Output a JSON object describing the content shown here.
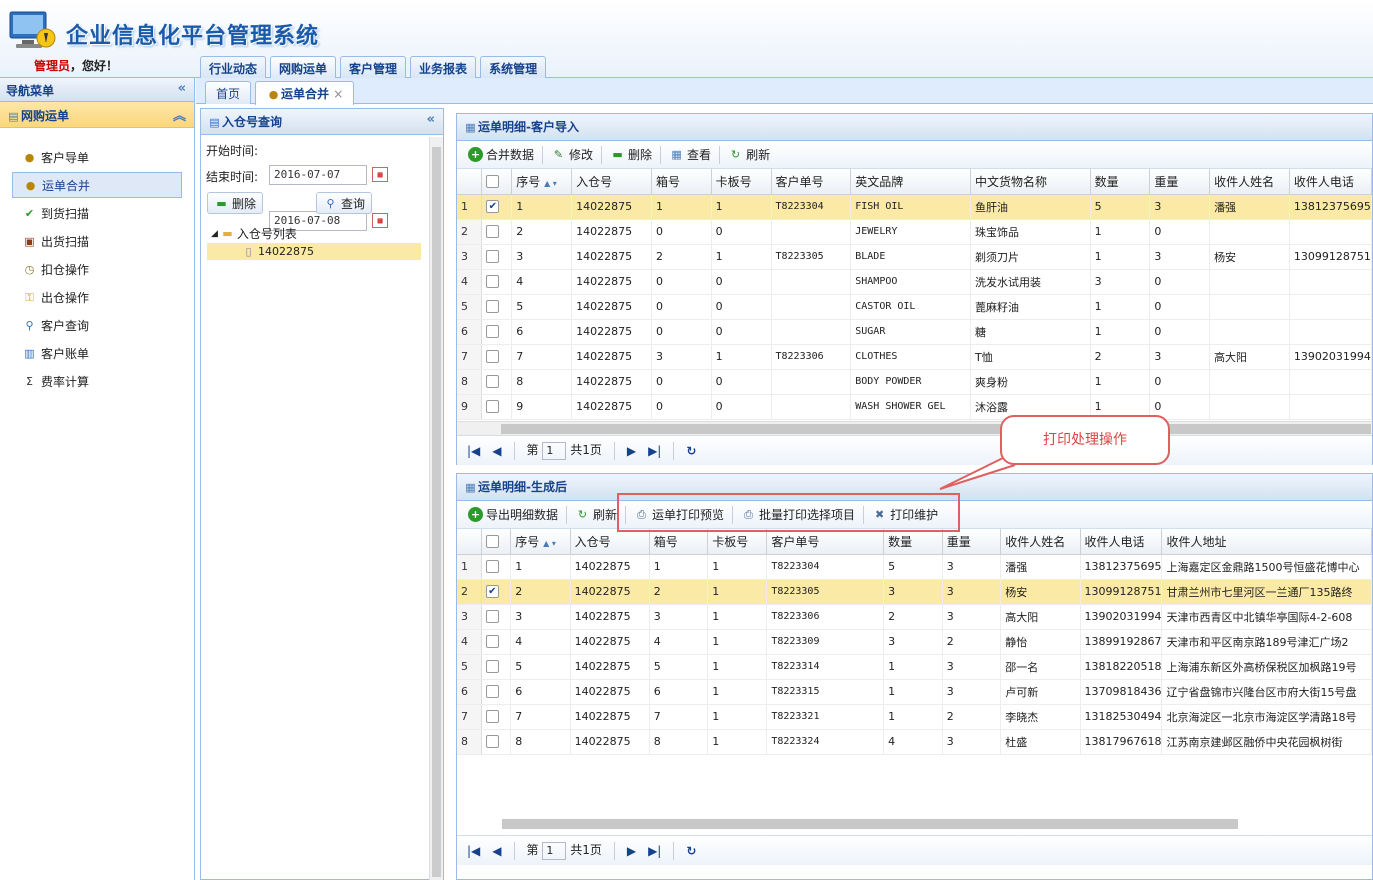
{
  "header": {
    "title": "企业信息化平台管理系统",
    "greeting_role": "管理员",
    "greeting_suffix": "，您好！"
  },
  "topnav": [
    "行业动态",
    "网购运单",
    "客户管理",
    "业务报表",
    "系统管理"
  ],
  "nav": {
    "title": "导航菜单",
    "section": "网购运单",
    "items": [
      {
        "label": "客户导单",
        "icon": "user-icon"
      },
      {
        "label": "运单合并",
        "icon": "users-icon"
      },
      {
        "label": "到货扫描",
        "icon": "check-icon"
      },
      {
        "label": "出货扫描",
        "icon": "image-icon"
      },
      {
        "label": "扣仓操作",
        "icon": "clock-icon"
      },
      {
        "label": "出仓操作",
        "icon": "key-icon"
      },
      {
        "label": "客户查询",
        "icon": "magnifier-icon"
      },
      {
        "label": "客户账单",
        "icon": "book-icon"
      },
      {
        "label": "费率计算",
        "icon": "sigma-icon"
      }
    ]
  },
  "tabs": {
    "home": "首页",
    "active": "运单合并",
    "close": "×"
  },
  "query": {
    "title": "入仓号查询",
    "start_label": "开始时间:",
    "start_value": "2016-07-07",
    "end_label": "结束时间:",
    "end_value": "2016-07-08",
    "delete": "删除",
    "search": "查询",
    "tree_root": "入仓号列表",
    "tree_item": "14022875"
  },
  "grid1": {
    "title": "运单明细-客户导入",
    "toolbar": [
      "合并数据",
      "修改",
      "删除",
      "查看",
      "刷新"
    ],
    "columns": [
      "序号",
      "入仓号",
      "箱号",
      "卡板号",
      "客户单号",
      "英文品牌",
      "中文货物名称",
      "数量",
      "重量",
      "收件人姓名",
      "收件人电话"
    ],
    "rows": [
      {
        "checked": true,
        "cells": [
          "1",
          "14022875",
          "1",
          "1",
          "T8223304",
          "FISH OIL",
          "鱼肝油",
          "5",
          "3",
          "潘强",
          "13812375695"
        ]
      },
      {
        "checked": false,
        "cells": [
          "2",
          "14022875",
          "0",
          "0",
          "",
          "JEWELRY",
          "珠宝饰品",
          "1",
          "0",
          "",
          ""
        ]
      },
      {
        "checked": false,
        "cells": [
          "3",
          "14022875",
          "2",
          "1",
          "T8223305",
          "BLADE",
          "剃须刀片",
          "1",
          "3",
          "杨安",
          "13099128751"
        ]
      },
      {
        "checked": false,
        "cells": [
          "4",
          "14022875",
          "0",
          "0",
          "",
          "SHAMPOO",
          "洗发水试用装",
          "3",
          "0",
          "",
          ""
        ]
      },
      {
        "checked": false,
        "cells": [
          "5",
          "14022875",
          "0",
          "0",
          "",
          "CASTOR OIL",
          "蓖麻籽油",
          "1",
          "0",
          "",
          ""
        ]
      },
      {
        "checked": false,
        "cells": [
          "6",
          "14022875",
          "0",
          "0",
          "",
          "SUGAR",
          "糖",
          "1",
          "0",
          "",
          ""
        ]
      },
      {
        "checked": false,
        "cells": [
          "7",
          "14022875",
          "3",
          "1",
          "T8223306",
          "CLOTHES",
          "T恤",
          "2",
          "3",
          "高大阳",
          "13902031994"
        ]
      },
      {
        "checked": false,
        "cells": [
          "8",
          "14022875",
          "0",
          "0",
          "",
          "BODY POWDER",
          "爽身粉",
          "1",
          "0",
          "",
          ""
        ]
      },
      {
        "checked": false,
        "cells": [
          "9",
          "14022875",
          "0",
          "0",
          "",
          "WASH SHOWER GEL",
          "沐浴露",
          "1",
          "0",
          "",
          ""
        ]
      }
    ],
    "pager": {
      "prefix": "第",
      "page": "1",
      "total": "共1页"
    }
  },
  "grid2": {
    "title": "运单明细-生成后",
    "toolbar": [
      "导出明细数据",
      "刷新",
      "运单打印预览",
      "批量打印选择项目",
      "打印维护"
    ],
    "columns": [
      "序号",
      "入仓号",
      "箱号",
      "卡板号",
      "客户单号",
      "数量",
      "重量",
      "收件人姓名",
      "收件人电话",
      "收件人地址"
    ],
    "rows": [
      {
        "checked": false,
        "cells": [
          "1",
          "14022875",
          "1",
          "1",
          "T8223304",
          "5",
          "3",
          "潘强",
          "13812375695",
          "上海嘉定区金鼎路1500号恒盛花博中心"
        ]
      },
      {
        "checked": true,
        "cells": [
          "2",
          "14022875",
          "2",
          "1",
          "T8223305",
          "3",
          "3",
          "杨安",
          "13099128751",
          "甘肃兰州市七里河区一兰通厂135路终"
        ]
      },
      {
        "checked": false,
        "cells": [
          "3",
          "14022875",
          "3",
          "1",
          "T8223306",
          "2",
          "3",
          "高大阳",
          "13902031994",
          "天津市西青区中北镇华亭国际4-2-608"
        ]
      },
      {
        "checked": false,
        "cells": [
          "4",
          "14022875",
          "4",
          "1",
          "T8223309",
          "3",
          "2",
          "静怡",
          "13899192867",
          "天津市和平区南京路189号津汇广场2"
        ]
      },
      {
        "checked": false,
        "cells": [
          "5",
          "14022875",
          "5",
          "1",
          "T8223314",
          "1",
          "3",
          "邵一名",
          "13818220518",
          "上海浦东新区外高桥保税区加枫路19号"
        ]
      },
      {
        "checked": false,
        "cells": [
          "6",
          "14022875",
          "6",
          "1",
          "T8223315",
          "1",
          "3",
          "卢可新",
          "13709818436",
          "辽宁省盘锦市兴隆台区市府大街15号盘"
        ]
      },
      {
        "checked": false,
        "cells": [
          "7",
          "14022875",
          "7",
          "1",
          "T8223321",
          "1",
          "2",
          "李晓杰",
          "13182530494",
          "北京海淀区一北京市海淀区学清路18号"
        ]
      },
      {
        "checked": false,
        "cells": [
          "8",
          "14022875",
          "8",
          "1",
          "T8223324",
          "4",
          "3",
          "杜盛",
          "13817967618",
          "江苏南京建邺区融侨中央花园枫树街"
        ]
      }
    ],
    "pager": {
      "prefix": "第",
      "page": "1",
      "total": "共1页"
    }
  },
  "callout": "打印处理操作",
  "colors": {
    "accent": "#15428b",
    "border": "#99bbe8",
    "selected_row": "#fbe9a6",
    "highlight": "#e06060"
  }
}
